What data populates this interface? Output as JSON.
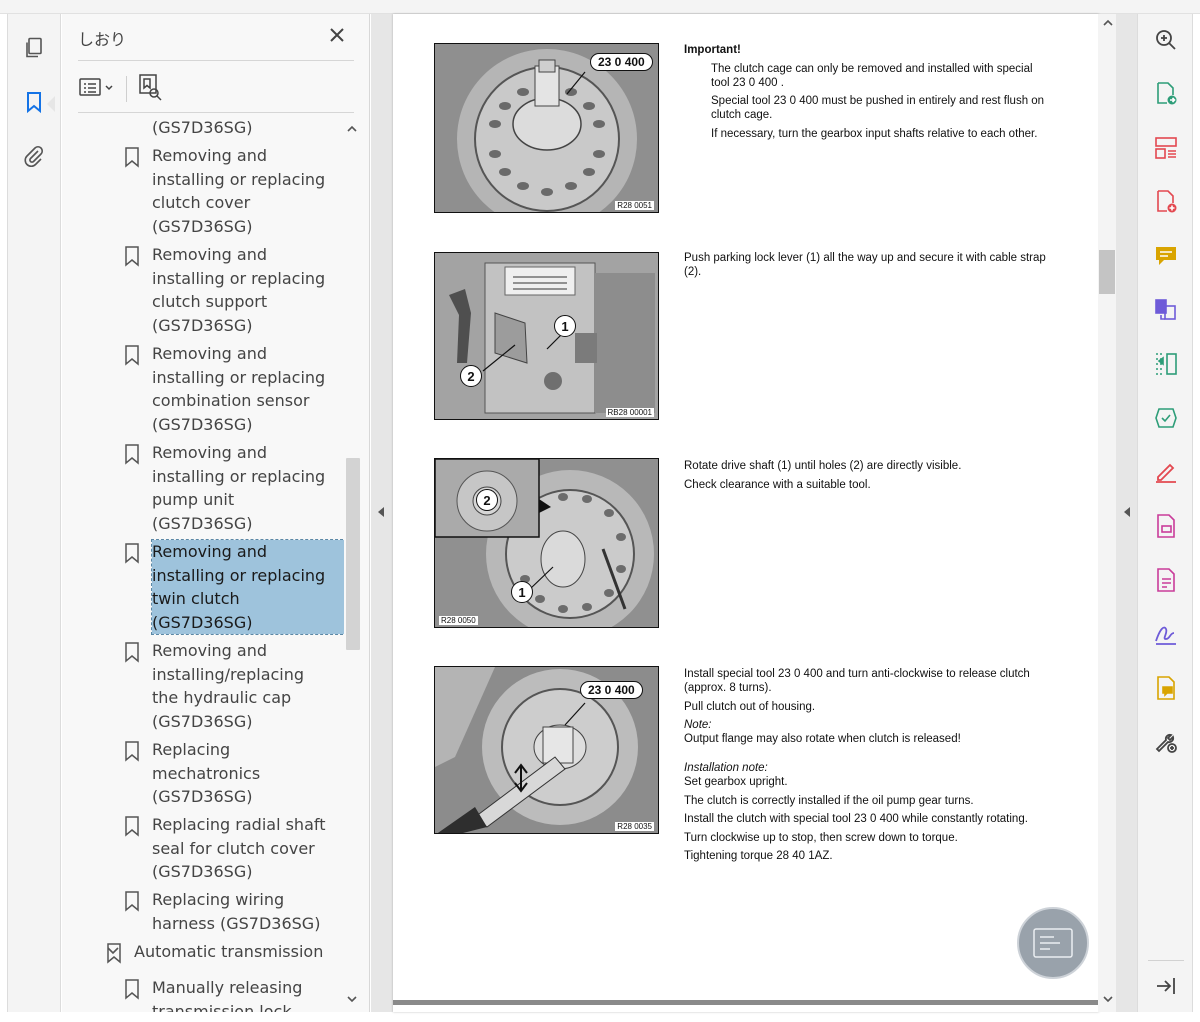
{
  "bookmarks_panel": {
    "title": "しおり",
    "items": [
      {
        "label": "(GS7D36SG)"
      },
      {
        "label": "Removing and\ninstalling or replacing\nclutch cover\n(GS7D36SG)"
      },
      {
        "label": "Removing and\ninstalling or replacing\nclutch support\n(GS7D36SG)"
      },
      {
        "label": "Removing and\ninstalling or replacing\ncombination sensor\n(GS7D36SG)"
      },
      {
        "label": "Removing and\ninstalling or replacing\npump unit\n(GS7D36SG)"
      },
      {
        "label": "Removing and\ninstalling or replacing\ntwin clutch\n(GS7D36SG)"
      },
      {
        "label": "Removing and\ninstalling/replacing\nthe hydraulic cap\n(GS7D36SG)"
      },
      {
        "label": "Replacing\nmechatronics\n(GS7D36SG)"
      },
      {
        "label": "Replacing radial shaft\nseal for clutch cover\n(GS7D36SG)"
      },
      {
        "label": "Replacing wiring\nharness (GS7D36SG)"
      },
      {
        "label": "Automatic transmission"
      },
      {
        "label": "Manually releasing\ntransmission lock"
      }
    ]
  },
  "document": {
    "figures": [
      {
        "code": "R28 0051",
        "callout": "23 0 400"
      },
      {
        "code": "RB28 00001",
        "labels": [
          "1",
          "2"
        ]
      },
      {
        "code": "R28 0050",
        "labels": [
          "2",
          "1"
        ]
      },
      {
        "code": "R28 0035",
        "callout": "23 0 400"
      }
    ],
    "step1": {
      "heading": "Important!",
      "lines": [
        "The clutch cage can only be removed and installed with special tool 23 0 400 .",
        "Special tool 23 0 400 must be pushed in entirely and rest flush on clutch cage.",
        "If necessary, turn the gearbox input shafts relative to each other."
      ]
    },
    "step2": {
      "lines": [
        "Push parking lock lever (1) all the way up and secure it with cable strap (2)."
      ]
    },
    "step3": {
      "lines": [
        "Rotate drive shaft (1) until holes (2) are directly visible.",
        "Check clearance with a suitable tool."
      ]
    },
    "step4": {
      "line1": "Install special tool 23 0 400 and turn anti-clockwise to release clutch (approx. 8 turns).",
      "line2": "Pull clutch out of housing.",
      "note_label": "Note:",
      "note": "Output flange may also rotate when clutch is released!",
      "install_label": "Installation note:",
      "install_lines": [
        "Set gearbox upright.",
        "The clutch is correctly installed if the oil pump gear turns.",
        "Install the clutch with special tool 23 0 400 while constantly rotating.",
        "Turn clockwise up to stop, then screw down to torque.",
        "Tightening torque 28 40 1AZ."
      ]
    }
  },
  "icons": {
    "left_rail": [
      "pages-icon",
      "bookmark-icon",
      "attachment-icon"
    ],
    "right_rail": [
      "zoom-icon",
      "export-pdf-icon",
      "organize-pages-icon",
      "create-pdf-icon",
      "comment-icon",
      "combine-files-icon",
      "compress-icon",
      "edit-pdf-icon",
      "fill-sign-icon",
      "protect-icon",
      "redact-icon",
      "request-signature-icon",
      "send-comments-icon",
      "more-tools-icon",
      "collapse-panel-icon"
    ]
  },
  "colors": {
    "selection": "#9ec3dc",
    "accent_blue": "#1473e6",
    "tool_red": "#e34850",
    "tool_pink": "#c93c9a",
    "tool_yellow": "#d9a400",
    "tool_green": "#2d9d78",
    "tool_purple": "#6e5bd8"
  }
}
